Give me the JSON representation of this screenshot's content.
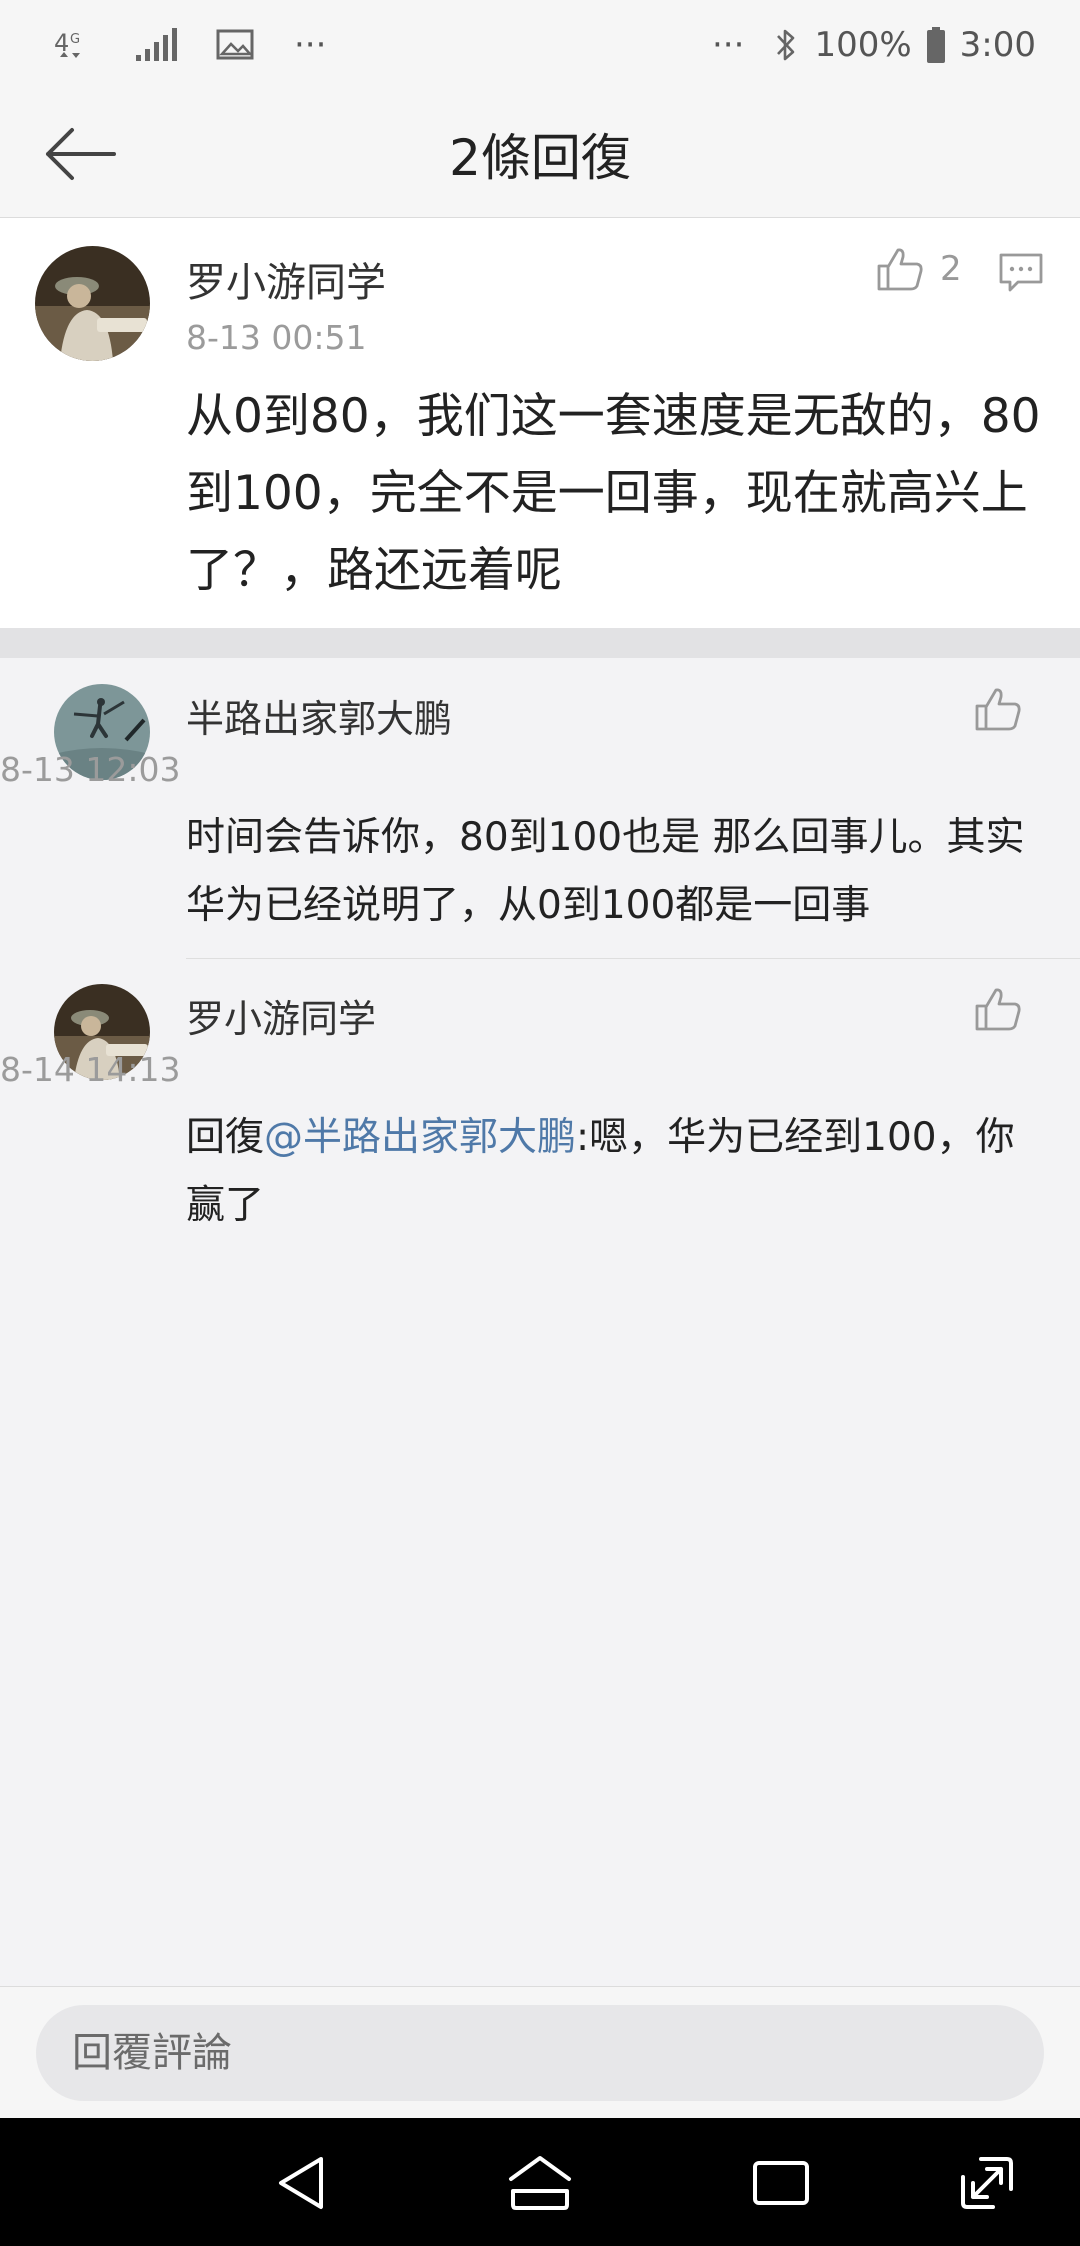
{
  "status_bar": {
    "network": "4G",
    "battery": "100%",
    "time": "3:00",
    "more_left": "···",
    "more_right": "···"
  },
  "header": {
    "title": "2條回復"
  },
  "main_comment": {
    "username": "罗小游同学",
    "time": "8-13 00:51",
    "text": "从0到80，我们这一套速度是无敌的，80到100，完全不是一回事，现在就高兴上了？，路还远着呢",
    "likes": "2"
  },
  "replies": [
    {
      "username": "半路出家郭大鹏",
      "time": "8-13 12:03",
      "text": "时间会告诉你，80到100也是 那么回事儿。其实华为已经说明了，从0到100都是一回事"
    },
    {
      "username": "罗小游同学",
      "time": "8-14 14:13",
      "prefix": "回復",
      "mention": "@半路出家郭大鹏",
      "text": ":嗯，华为已经到100，你赢了"
    }
  ],
  "input": {
    "placeholder": "回覆評論"
  },
  "colors": {
    "mention": "#4f79a8",
    "background": "#eeedf2"
  }
}
